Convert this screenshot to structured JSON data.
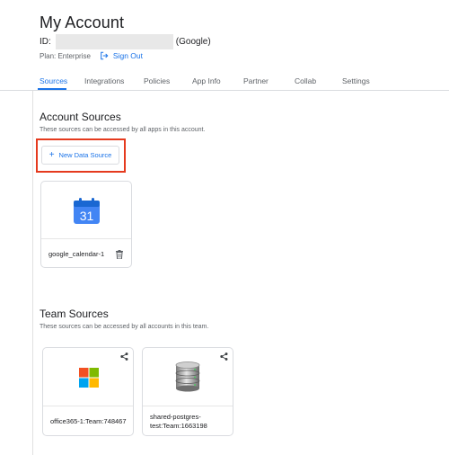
{
  "header": {
    "title": "My Account",
    "id_label": "ID:",
    "id_provider": "(Google)",
    "plan": "Plan: Enterprise",
    "sign_out": "Sign Out"
  },
  "tabs": [
    {
      "label": "Sources",
      "active": true
    },
    {
      "label": "Integrations",
      "active": false
    },
    {
      "label": "Policies",
      "active": false
    },
    {
      "label": "App Info",
      "active": false
    },
    {
      "label": "Partner",
      "active": false
    },
    {
      "label": "Collab",
      "active": false
    },
    {
      "label": "Settings",
      "active": false
    }
  ],
  "account_sources": {
    "title": "Account Sources",
    "subtitle": "These sources can be accessed by all apps in this account.",
    "new_button": "New Data Source",
    "cards": [
      {
        "name": "google_calendar-1",
        "icon": "google-calendar-icon",
        "icon_text": "31"
      }
    ]
  },
  "team_sources": {
    "title": "Team Sources",
    "subtitle": "These sources can be accessed by all accounts in this team.",
    "cards": [
      {
        "name": "office365-1:Team:748467",
        "icon": "microsoft-icon"
      },
      {
        "name_line1": "shared-postgres-",
        "name_line2": "test:Team:1663198",
        "icon": "database-icon"
      }
    ]
  },
  "colors": {
    "accent": "#1a73e8",
    "highlight": "#e53a1e",
    "ms_red": "#f25022",
    "ms_green": "#7fba00",
    "ms_blue": "#00a4ef",
    "ms_yellow": "#ffb900"
  }
}
